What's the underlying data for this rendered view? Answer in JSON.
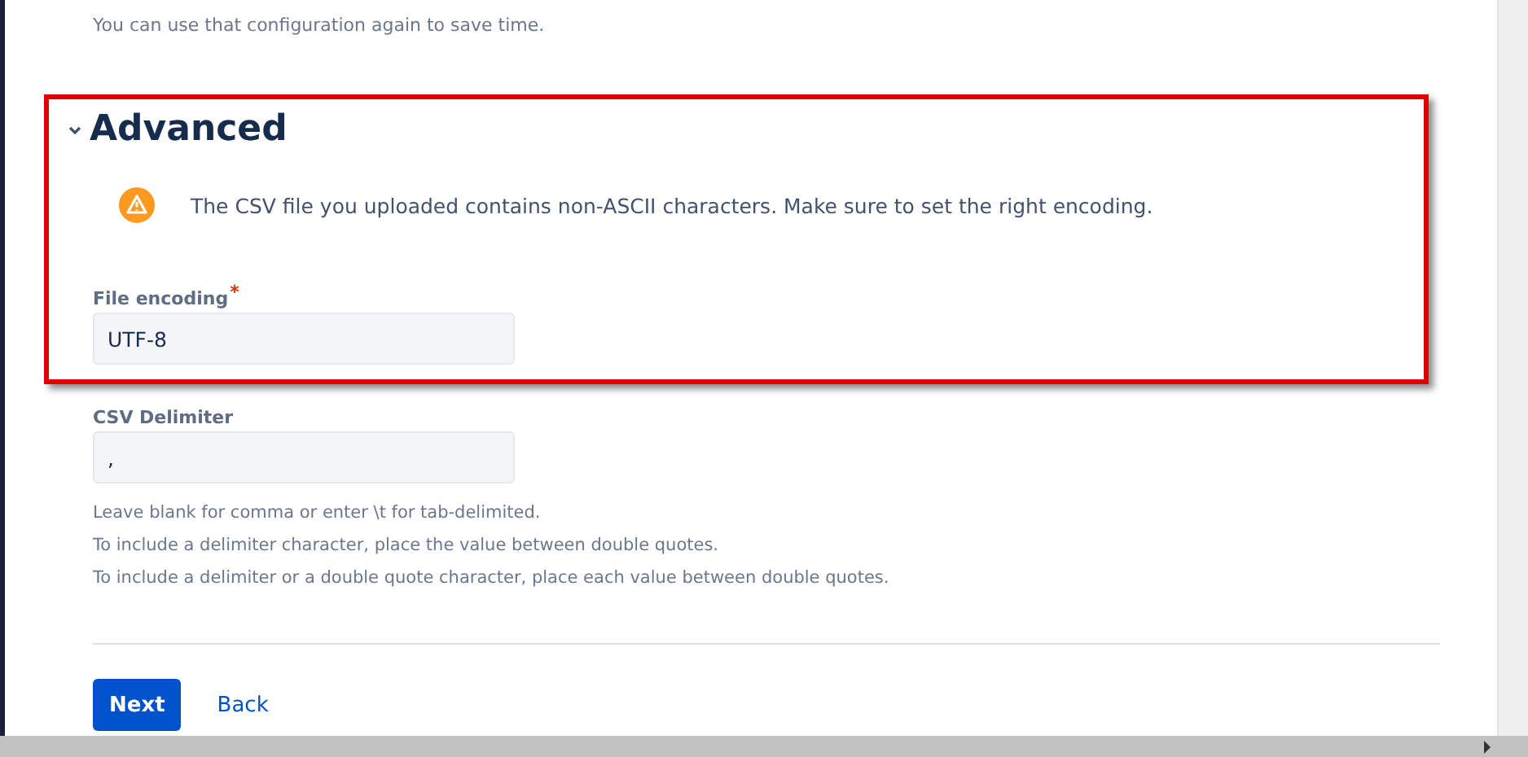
{
  "intro": "You can use that configuration again to save time.",
  "section": {
    "title": "Advanced",
    "expanded": true
  },
  "warning": "The CSV file you uploaded contains non-ASCII characters. Make sure to set the right encoding.",
  "fields": [
    {
      "label": "File encoding",
      "required_mark": "*",
      "value": "UTF-8"
    },
    {
      "label": "CSV Delimiter",
      "value": ","
    }
  ],
  "help": [
    "Leave blank for comma or enter \\t for tab-delimited.",
    "To include a delimiter character, place the value between double quotes.",
    "To include a delimiter or a double quote character, place each value between double quotes."
  ],
  "buttons": [
    {
      "label": "Next",
      "kind": "primary"
    },
    {
      "label": "Back",
      "kind": "link"
    }
  ]
}
